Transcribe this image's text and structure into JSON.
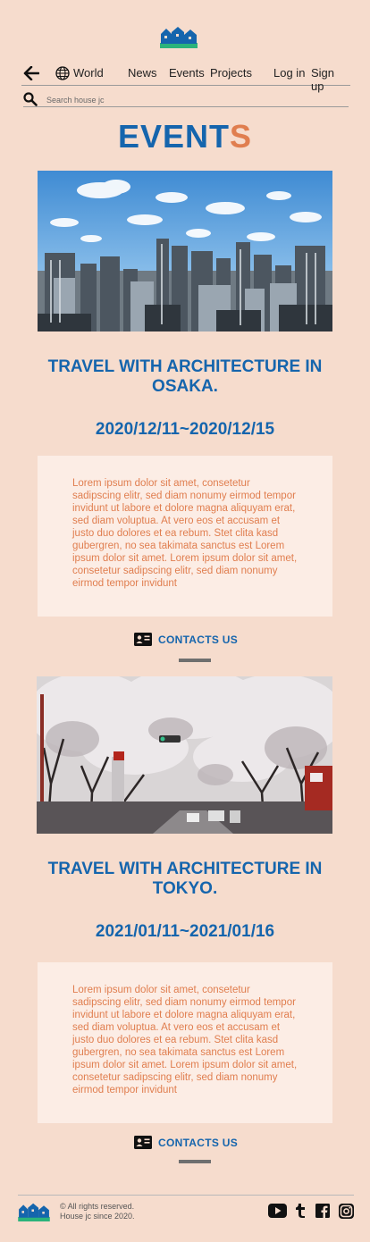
{
  "header": {
    "nav": {
      "world": "World",
      "news": "News",
      "events": "Events",
      "projects": "Projects",
      "login": "Log in",
      "signup": "Sign up"
    },
    "search": {
      "placeholder": "Search house jc"
    }
  },
  "page": {
    "title_main": "EVENT",
    "title_accent": "S"
  },
  "events": [
    {
      "title": "TRAVEL WITH ARCHITECTURE IN OSAKA.",
      "dates": "2020/12/11~2020/12/15",
      "description": "Lorem ipsum dolor sit amet, consetetur sadipscing elitr, sed diam nonumy eirmod tempor invidunt ut labore et dolore magna aliquyam erat, sed diam voluptua. At vero eos et accusam et justo duo dolores et ea rebum. Stet clita kasd gubergren, no sea takimata sanctus est Lorem ipsum dolor sit amet. Lorem ipsum dolor sit amet, consetetur sadipscing elitr, sed diam nonumy eirmod tempor invidunt",
      "contact_label": "CONTACTS US"
    },
    {
      "title": "TRAVEL WITH ARCHITECTURE IN TOKYO.",
      "dates": "2021/01/11~2021/01/16",
      "description": "Lorem ipsum dolor sit amet, consetetur sadipscing elitr, sed diam nonumy eirmod tempor invidunt ut labore et dolore magna aliquyam erat, sed diam voluptua. At vero eos et accusam et justo duo dolores et ea rebum. Stet clita kasd gubergren, no sea takimata sanctus est Lorem ipsum dolor sit amet. Lorem ipsum dolor sit amet, consetetur sadipscing elitr, sed diam nonumy eirmod tempor invidunt",
      "contact_label": "CONTACTS US"
    }
  ],
  "footer": {
    "copyright_line1": "© All rights reserved.",
    "copyright_line2": "House jc since 2020.",
    "social": [
      "youtube-icon",
      "tumblr-icon",
      "facebook-icon",
      "instagram-icon"
    ]
  },
  "colors": {
    "background": "#f6dccd",
    "primary_blue": "#1565ad",
    "accent_orange": "#e07e4f",
    "card_background": "#fcede5"
  }
}
